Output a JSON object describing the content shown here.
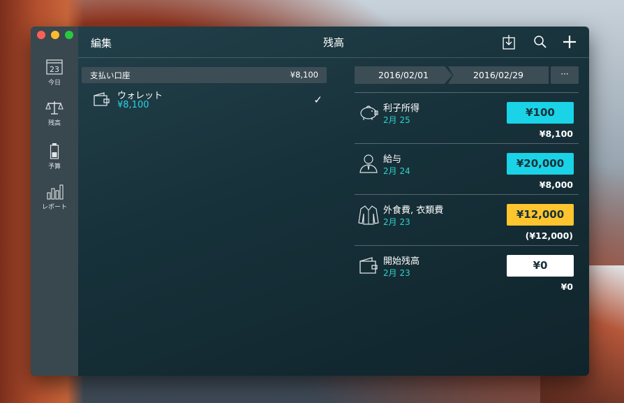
{
  "app": {
    "window_title": "残高",
    "toolbar": {
      "edit_label": "編集"
    }
  },
  "sidebar": {
    "items": [
      {
        "label": "今日",
        "icon": "calendar-icon",
        "calendar_day": "23"
      },
      {
        "label": "残高",
        "icon": "scale-icon"
      },
      {
        "label": "予算",
        "icon": "battery-icon"
      },
      {
        "label": "レポート",
        "icon": "bar-chart-icon"
      }
    ]
  },
  "accounts": {
    "group_name": "支払い口座",
    "group_total": "¥8,100",
    "items": [
      {
        "name": "ウォレット",
        "amount": "¥8,100",
        "icon": "wallet-icon",
        "selected": true,
        "check": "✓"
      }
    ]
  },
  "period": {
    "start": "2016/02/01",
    "end": "2016/02/29",
    "more_label": "···"
  },
  "transactions": [
    {
      "category": "利子所得",
      "date": "2月 25",
      "amount": "¥100",
      "running_balance": "¥8,100",
      "icon": "piggy-bank-icon",
      "badge_color": "#1ad3e6"
    },
    {
      "category": "給与",
      "date": "2月 24",
      "amount": "¥20,000",
      "running_balance": "¥8,000",
      "icon": "person-icon",
      "badge_color": "#1ad3e6"
    },
    {
      "category": "外食費, 衣類費",
      "date": "2月 23",
      "amount": "¥12,000",
      "running_balance": "(¥12,000)",
      "icon": "shirt-icon",
      "badge_color": "#ffc52e"
    },
    {
      "category": "開始残高",
      "date": "2月 23",
      "amount": "¥0",
      "running_balance": "¥0",
      "icon": "wallet-icon",
      "badge_color": "#ffffff"
    }
  ],
  "colors": {
    "income": "#1ad3e6",
    "expense": "#ffc52e",
    "neutral": "#ffffff",
    "accent_text": "#27d3e4"
  }
}
